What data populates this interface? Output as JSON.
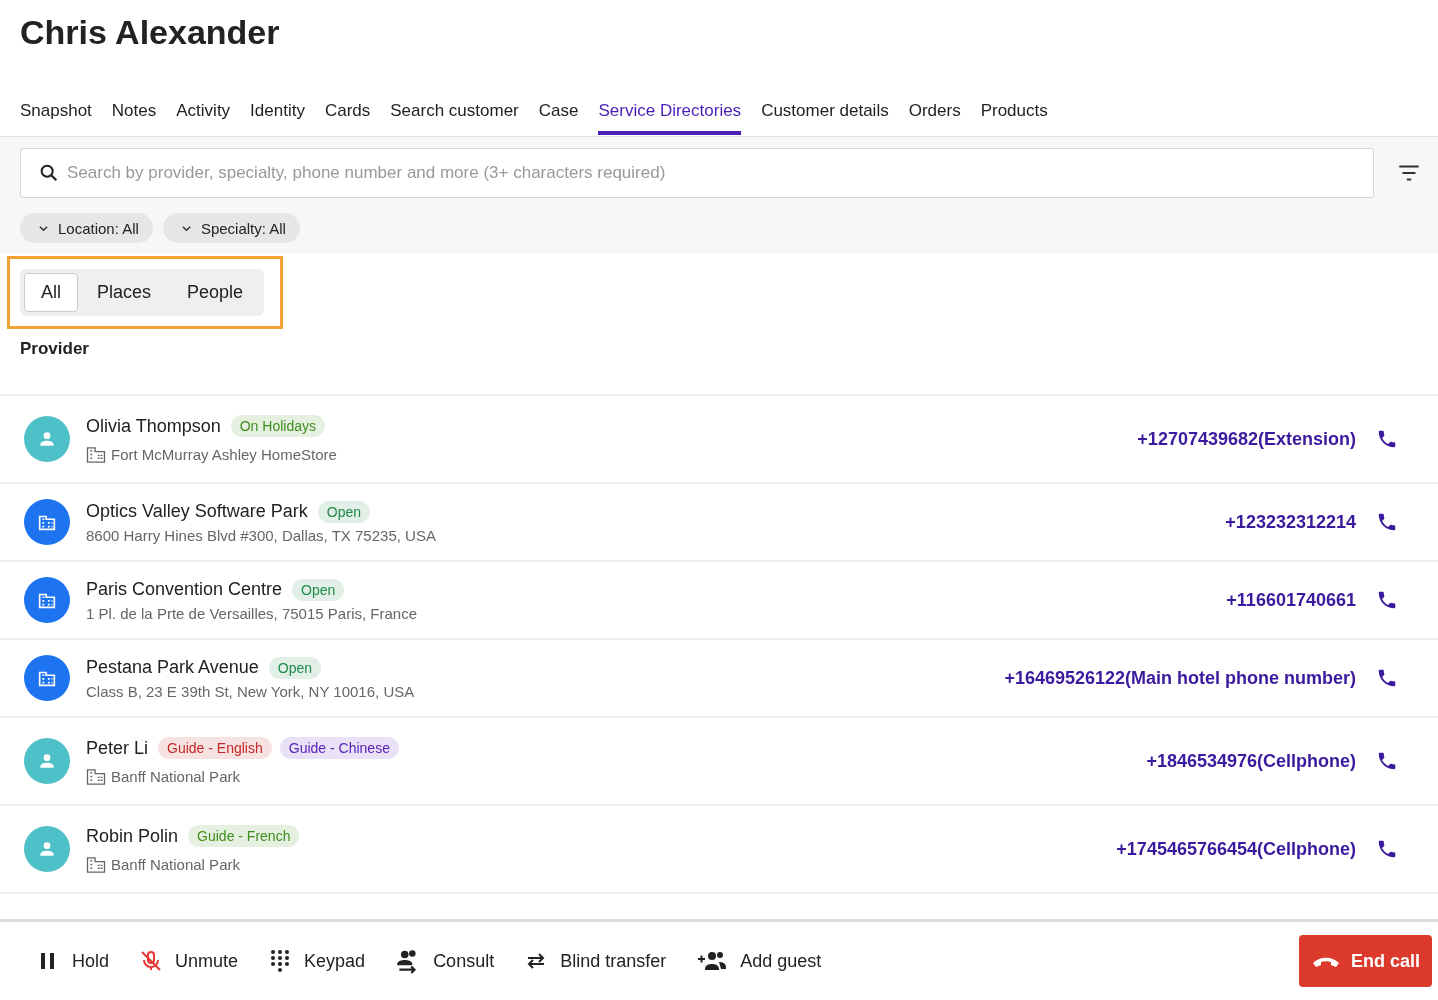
{
  "title": "Chris Alexander",
  "tabs": [
    {
      "label": "Snapshot",
      "selected": false
    },
    {
      "label": "Notes",
      "selected": false
    },
    {
      "label": "Activity",
      "selected": false
    },
    {
      "label": "Identity",
      "selected": false
    },
    {
      "label": "Cards",
      "selected": false
    },
    {
      "label": "Search customer",
      "selected": false
    },
    {
      "label": "Case",
      "selected": false
    },
    {
      "label": "Service Directories",
      "selected": true
    },
    {
      "label": "Customer details",
      "selected": false
    },
    {
      "label": "Orders",
      "selected": false
    },
    {
      "label": "Products",
      "selected": false
    }
  ],
  "search": {
    "placeholder": "Search by provider, specialty, phone number and more (3+ characters required)"
  },
  "filters": [
    "Location: All",
    "Specialty: All"
  ],
  "segments": [
    {
      "label": "All",
      "selected": true
    },
    {
      "label": "Places",
      "selected": false
    },
    {
      "label": "People",
      "selected": false
    }
  ],
  "list_heading": "Provider",
  "providers": [
    {
      "kind": "person",
      "name": "Olivia Thompson",
      "tags": [
        {
          "label": "On Holidays",
          "color": "#3f8f1e"
        }
      ],
      "detail": "Fort McMurray Ashley HomeStore",
      "phone": "+12707439682(Extension)"
    },
    {
      "kind": "place",
      "name": "Optics Valley Software Park",
      "tags": [
        {
          "label": "Open",
          "color": "#1e8a4a"
        }
      ],
      "detail": "8600 Harry Hines Blvd #300, Dallas, TX 75235, USA",
      "phone": "+123232312214"
    },
    {
      "kind": "place",
      "name": "Paris Convention Centre",
      "tags": [
        {
          "label": "Open",
          "color": "#1e8a4a"
        }
      ],
      "detail": "1 Pl. de la Prte de Versailles, 75015 Paris, France",
      "phone": "+116601740661"
    },
    {
      "kind": "place",
      "name": "Pestana Park Avenue",
      "tags": [
        {
          "label": "Open",
          "color": "#1e8a4a"
        }
      ],
      "detail": "Class B, 23 E 39th St, New York, NY 10016, USA",
      "phone": "+16469526122(Main hotel phone number)"
    },
    {
      "kind": "person",
      "name": "Peter Li",
      "tags": [
        {
          "label": "Guide - English",
          "color": "#c62828"
        },
        {
          "label": "Guide - Chinese",
          "color": "#5b21b6"
        }
      ],
      "detail": "Banff National Park",
      "phone": "+1846534976(Cellphone)"
    },
    {
      "kind": "person",
      "name": "Robin Polin",
      "tags": [
        {
          "label": "Guide - French",
          "color": "#3f8f1e"
        }
      ],
      "detail": "Banff National Park",
      "phone": "+1745465766454(Cellphone)"
    }
  ],
  "call_actions": [
    {
      "kind": "hold",
      "label": "Hold"
    },
    {
      "kind": "unmute",
      "label": "Unmute"
    },
    {
      "kind": "keypad",
      "label": "Keypad"
    },
    {
      "kind": "consult",
      "label": "Consult"
    },
    {
      "kind": "transfer",
      "label": "Blind transfer"
    },
    {
      "kind": "guest",
      "label": "Add guest"
    }
  ],
  "end_call": "End call"
}
